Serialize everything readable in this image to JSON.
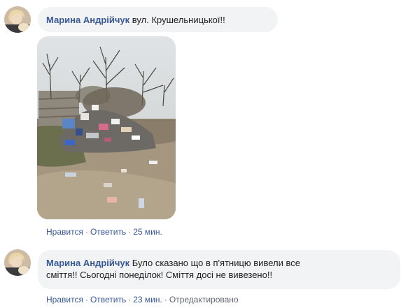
{
  "comments": [
    {
      "author": "Марина Андрійчук",
      "text": "вул. Крушельницької!!",
      "has_photo": true,
      "actions": {
        "like": "Нравится",
        "reply": "Ответить",
        "time": "25 мин."
      }
    },
    {
      "author": "Марина Андрійчук",
      "text_line1": "Було сказано що в п'ятницю вивели все",
      "text_line2": "сміття!! Сьогодні понеділок! Сміття досі не вивезено!!",
      "actions": {
        "like": "Нравится",
        "reply": "Ответить",
        "time": "23 мин.",
        "edited": "Отредактировано"
      }
    }
  ],
  "separator": "·",
  "colors": {
    "link": "#385898",
    "bubble": "#f2f3f5",
    "meta": "#606770"
  }
}
